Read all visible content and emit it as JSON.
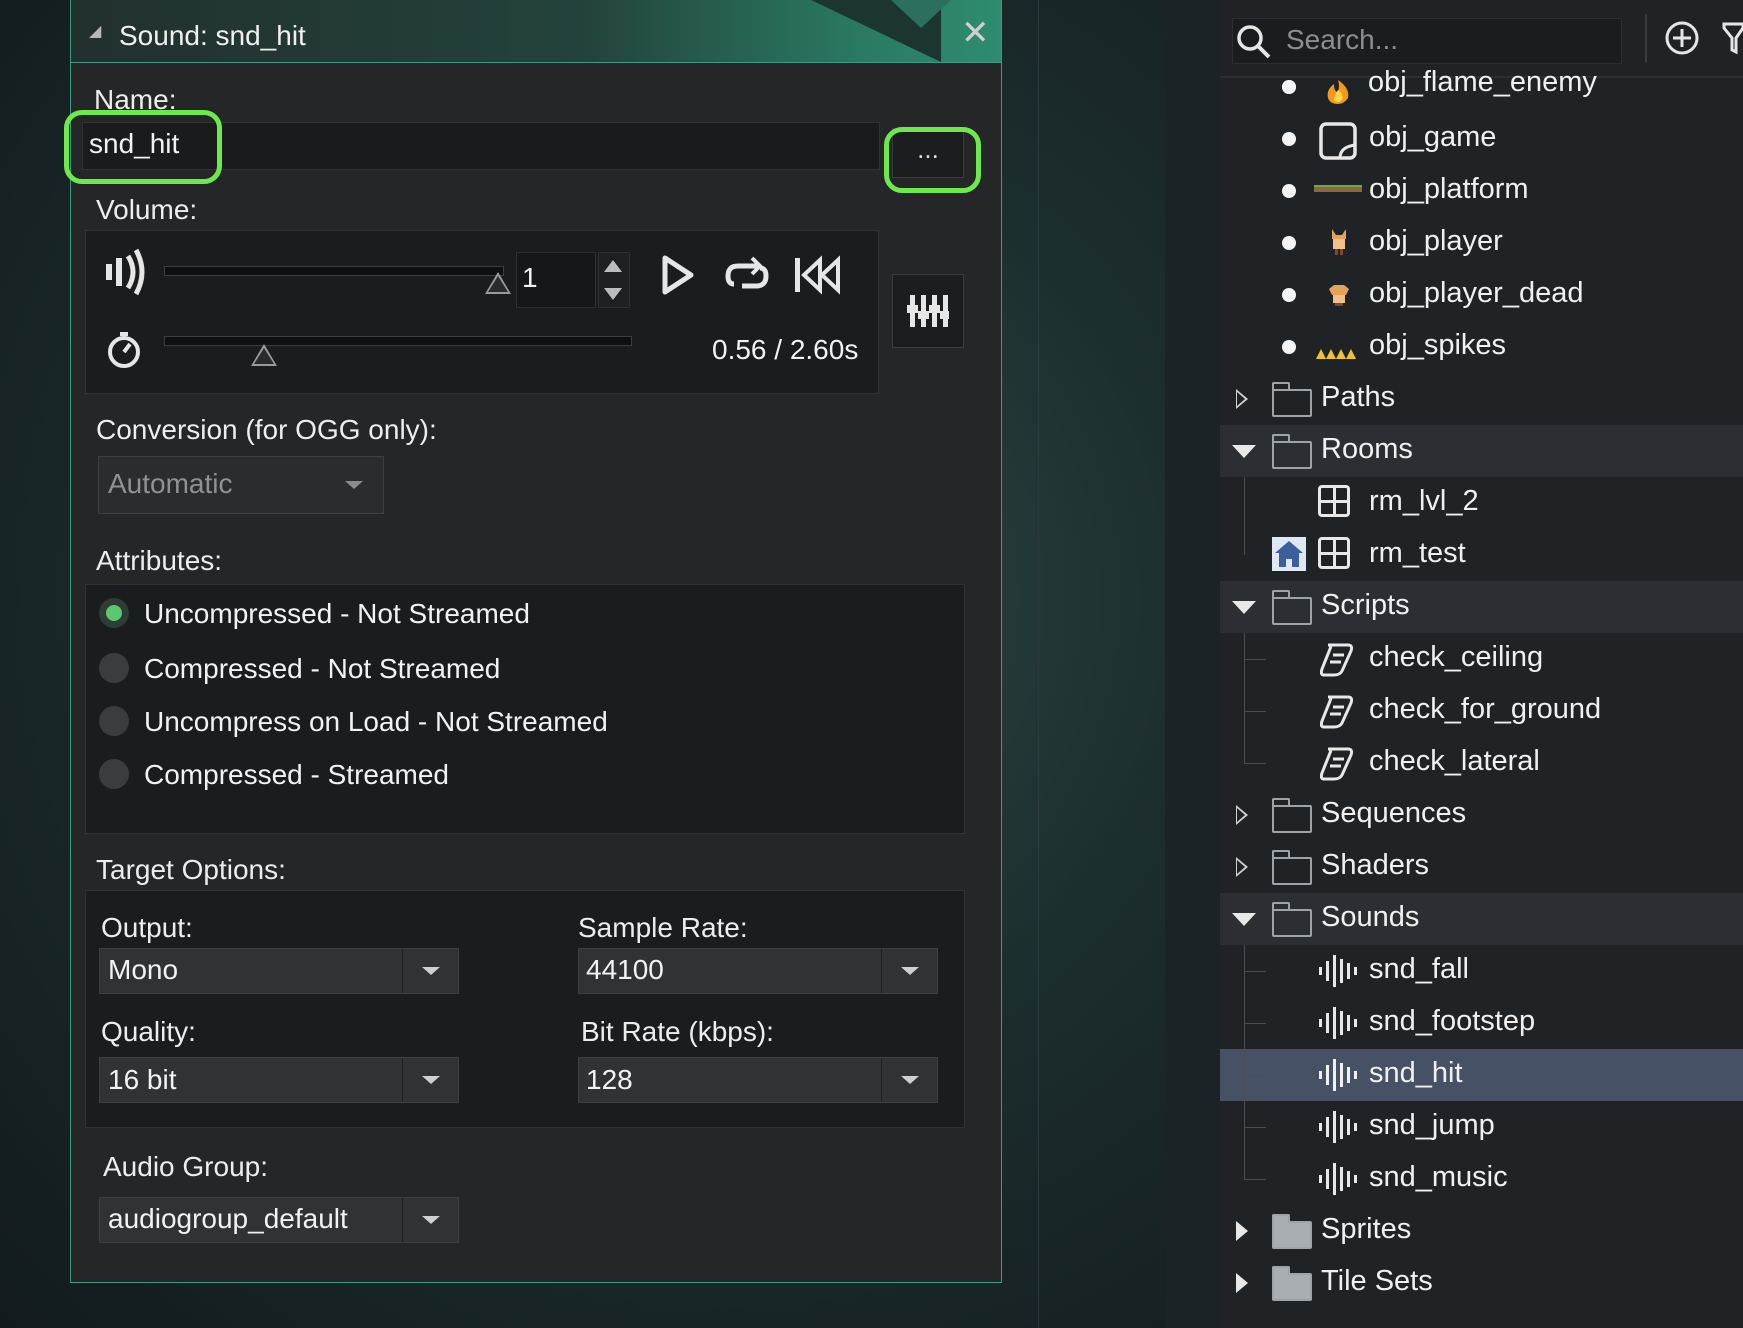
{
  "window": {
    "title": "Sound: snd_hit",
    "close_glyph": "✕"
  },
  "name": {
    "label": "Name:",
    "value": "snd_hit",
    "browse_label": "..."
  },
  "volume": {
    "label": "Volume:",
    "value": "1",
    "volume_level": 1.0,
    "time_readout": "0.56 / 2.60s",
    "playback_position": 0.215
  },
  "conversion": {
    "label": "Conversion (for OGG only):",
    "selected": "Automatic"
  },
  "attributes": {
    "label": "Attributes:",
    "options": [
      "Uncompressed - Not Streamed",
      "Compressed - Not Streamed",
      "Uncompress on Load - Not Streamed",
      "Compressed - Streamed"
    ],
    "selected_index": 0
  },
  "target": {
    "label": "Target Options:",
    "output_label": "Output:",
    "output_value": "Mono",
    "sample_rate_label": "Sample Rate:",
    "sample_rate_value": "44100",
    "quality_label": "Quality:",
    "quality_value": "16 bit",
    "bit_rate_label": "Bit Rate (kbps):",
    "bit_rate_value": "128"
  },
  "audio_group": {
    "label": "Audio Group:",
    "value": "audiogroup_default"
  },
  "asset_browser": {
    "search_placeholder": "Search...",
    "objects": [
      "obj_flame_enemy",
      "obj_game",
      "obj_platform",
      "obj_player",
      "obj_player_dead",
      "obj_spikes"
    ],
    "folders": {
      "paths": "Paths",
      "rooms": "Rooms",
      "scripts": "Scripts",
      "sequences": "Sequences",
      "shaders": "Shaders",
      "sounds": "Sounds",
      "sprites": "Sprites",
      "tile_sets": "Tile Sets"
    },
    "rooms": [
      "rm_lvl_2",
      "rm_test"
    ],
    "scripts": [
      "check_ceiling",
      "check_for_ground",
      "check_lateral"
    ],
    "sounds": [
      "snd_fall",
      "snd_footstep",
      "snd_hit",
      "snd_jump",
      "snd_music"
    ],
    "selected_sound": "snd_hit"
  },
  "colors": {
    "accent_green": "#6ee84a",
    "window_border": "#3c9a82",
    "selected_row": "#475166"
  }
}
